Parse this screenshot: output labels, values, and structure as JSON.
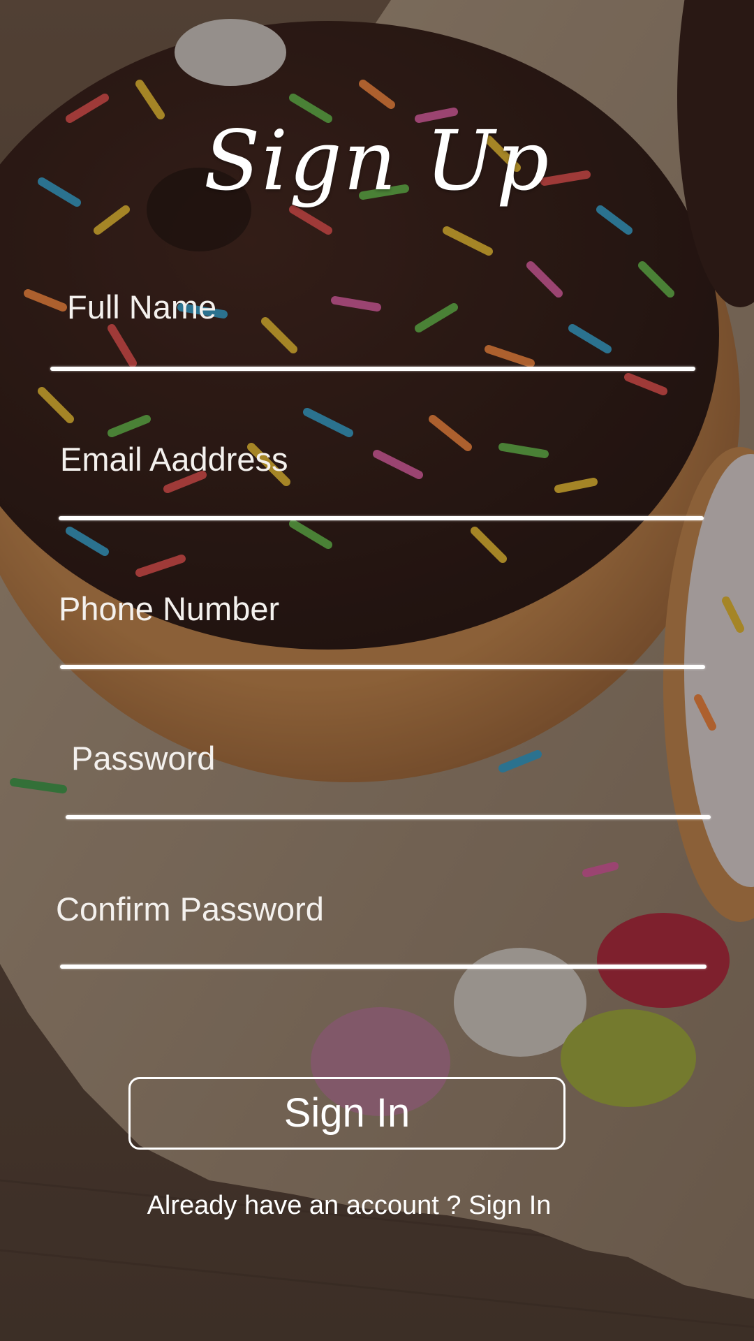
{
  "title": "Sign Up",
  "fields": [
    {
      "label": "Full Name"
    },
    {
      "label": "Email Aaddress"
    },
    {
      "label": "Phone Number"
    },
    {
      "label": "Password"
    },
    {
      "label": "Confirm Password"
    }
  ],
  "signin_button": {
    "label": "Sign In"
  },
  "footer": {
    "prompt": "Already have an account ?",
    "link": "Sign In"
  },
  "colors": {
    "text": "#ffffff",
    "underline": "#ffffff",
    "scrim": "#281c18"
  }
}
